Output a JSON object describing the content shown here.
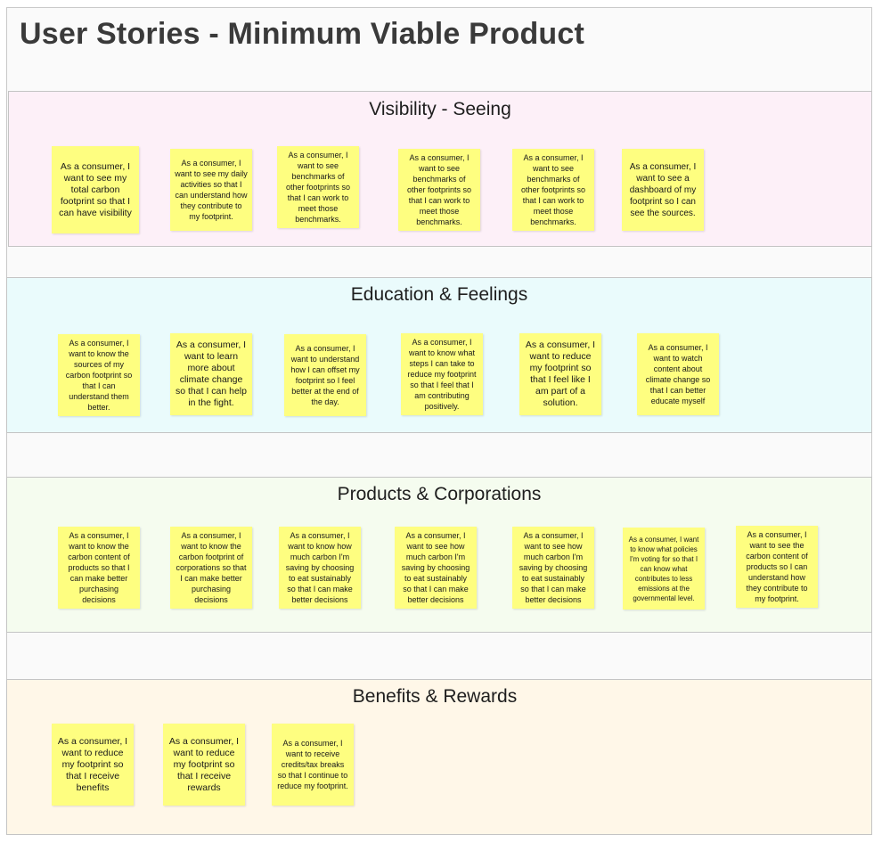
{
  "board": {
    "title": "User Stories - Minimum Viable Product"
  },
  "colors": {
    "sticky": "#fefe80",
    "visibility_bg": "#fdf0f8",
    "education_bg": "#eafbfc",
    "products_bg": "#f5fcef",
    "benefits_bg": "#fff7e8"
  },
  "sections": {
    "visibility": {
      "title": "Visibility - Seeing",
      "notes": [
        "As a consumer, I want to see my total carbon footprint so that I can have visibility",
        "As a consumer, I want to see my daily activities so that I can understand how they contribute to my footprint.",
        "As a consumer, I want to see benchmarks of other footprints so that I can work to meet those benchmarks.",
        "As a consumer, I want to see benchmarks of other footprints so that I can work to meet those benchmarks.",
        "As a consumer, I want to see benchmarks of other footprints so that I can work to meet those benchmarks.",
        "As a consumer, I want to see a dashboard of my footprint so I can see the sources."
      ]
    },
    "education": {
      "title": "Education & Feelings",
      "notes": [
        "As a consumer, I want to know the sources of my carbon footprint so that I can understand them better.",
        "As a consumer, I want to learn more about climate change so that I can help in the fight.",
        "As a consumer, I want to understand how I can offset my footprint so I feel better at the end of the day.",
        "As a consumer, I want to know what steps I can take to reduce my footprint so that I feel that I am contributing positively.",
        "As a consumer, I want to reduce my footprint so that I feel like I am part of a solution.",
        "As a consumer, I want to watch content about climate change so that I can better educate myself"
      ]
    },
    "products": {
      "title": "Products & Corporations",
      "notes": [
        "As a consumer, I want to know the carbon content of products so that I can make better purchasing decisions",
        "As a consumer, I want to know the carbon footprint of corporations so that I can make better purchasing decisions",
        "As a consumer, I want to know how much carbon I'm saving by choosing to eat sustainably so that I can make better decisions",
        "As a consumer, I want to see how much carbon I'm saving by choosing to eat sustainably so that I can make better decisions",
        "As a consumer, I want to see how much carbon I'm saving by choosing to eat sustainably so that I can make better decisions",
        "As a consumer, I want to know what policies I'm voting for so that I can know what contributes to less emissions at the governmental level.",
        "As a consumer, I want to see the carbon content of products so I can understand how they contribute to my footprint."
      ]
    },
    "benefits": {
      "title": "Benefits & Rewards",
      "notes": [
        "As a consumer, I want to reduce my footprint so that I receive benefits",
        "As a consumer, I want to reduce my footprint so that I receive rewards",
        "As a consumer, I want to receive credits/tax breaks so that I continue to reduce my footprint."
      ]
    }
  }
}
